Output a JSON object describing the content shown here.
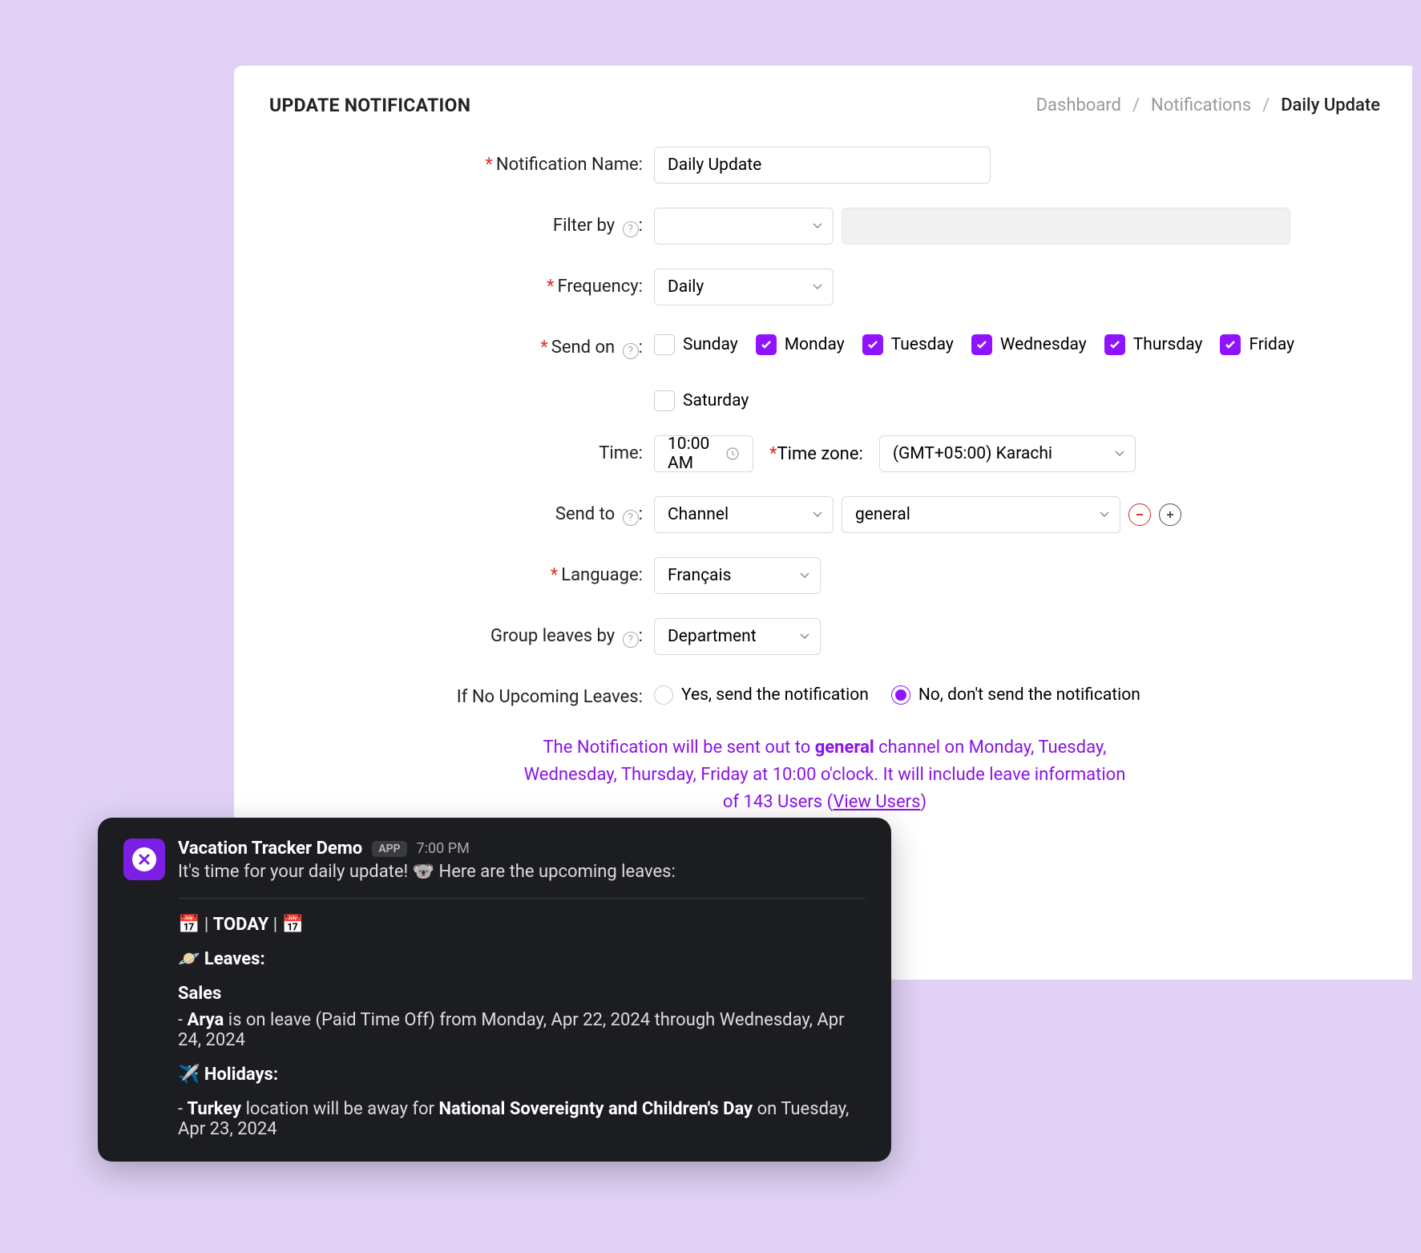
{
  "header": {
    "title": "UPDATE NOTIFICATION"
  },
  "breadcrumb": {
    "items": [
      "Dashboard",
      "Notifications",
      "Daily Update"
    ],
    "sep": "/"
  },
  "labels": {
    "name": "Notification Name:",
    "filter": "Filter by",
    "frequency": "Frequency:",
    "sendon": "Send on",
    "time": "Time:",
    "timezone": "Time zone:",
    "sendto": "Send to",
    "language": "Language:",
    "groupby": "Group leaves by",
    "noupcoming": "If No Upcoming Leaves:",
    "colon": ":"
  },
  "form": {
    "name": "Daily Update",
    "filter_by": "",
    "frequency": "Daily",
    "days": {
      "sunday": {
        "label": "Sunday",
        "checked": false
      },
      "monday": {
        "label": "Monday",
        "checked": true
      },
      "tuesday": {
        "label": "Tuesday",
        "checked": true
      },
      "wednesday": {
        "label": "Wednesday",
        "checked": true
      },
      "thursday": {
        "label": "Thursday",
        "checked": true
      },
      "friday": {
        "label": "Friday",
        "checked": true
      },
      "saturday": {
        "label": "Saturday",
        "checked": false
      }
    },
    "time": "10:00 AM",
    "timezone": "(GMT+05:00) Karachi",
    "send_to_type": "Channel",
    "send_to_target": "general",
    "language": "Français",
    "group_by": "Department",
    "no_upcoming_yes": "Yes, send the notification",
    "no_upcoming_no": "No, don't send the notification"
  },
  "summary": {
    "p1a": "The Notification will be sent out to ",
    "p1b": "general",
    "p1c": " channel on Monday, Tuesday, Wednesday, Thursday, Friday at 10:00 o'clock. It will include leave information of 143 Users (",
    "view_users": "View Users",
    "p1d": ")"
  },
  "slack": {
    "app_name": "Vacation Tracker Demo",
    "app_tag": "APP",
    "time": "7:00 PM",
    "intro": "It's time for your daily update! 🐨 Here are the upcoming leaves:",
    "today_title_a": "📅 | ",
    "today_title_b": "TODAY",
    "today_title_c": " | 📅",
    "leaves_header": "🪐 Leaves:",
    "dept1": "Sales",
    "leave_a": "- ",
    "leave_name": "Arya",
    "leave_b": " is on leave (Paid Time Off) from Monday, Apr 22, 2024 through Wednesday, Apr 24, 2024",
    "holidays_header": "✈️ Holidays:",
    "hol_a": "- ",
    "hol_loc": "Turkey",
    "hol_b": " location will be away for ",
    "hol_name": "National Sovereignty and Children's Day",
    "hol_c": " on Tuesday, Apr 23, 2024"
  }
}
